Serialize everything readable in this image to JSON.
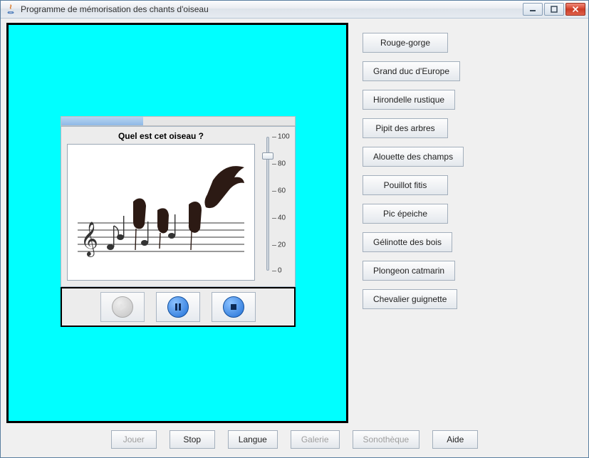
{
  "window": {
    "title": "Programme de mémorisation des chants d'oiseau"
  },
  "quiz": {
    "question": "Quel est cet oiseau ?",
    "progress_percent": 35
  },
  "volume": {
    "min": 0,
    "max": 100,
    "step": 20,
    "value": 85,
    "ticks": [
      "100",
      "80",
      "60",
      "40",
      "20",
      "0"
    ]
  },
  "birds": [
    "Rouge-gorge",
    "Grand duc d'Europe",
    "Hirondelle rustique",
    "Pipit des arbres",
    "Alouette des champs",
    "Pouillot fitis",
    "Pic épeiche",
    "Gélinotte des bois",
    "Plongeon catmarin",
    "Chevalier guignette"
  ],
  "toolbar": {
    "jouer": "Jouer",
    "stop": "Stop",
    "langue": "Langue",
    "galerie": "Galerie",
    "sonotheque": "Sonothèque",
    "aide": "Aide"
  }
}
